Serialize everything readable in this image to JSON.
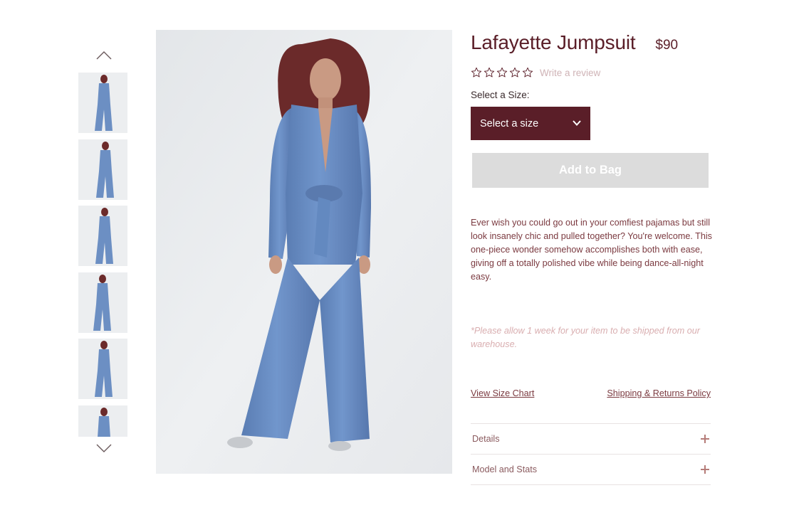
{
  "gallery": {
    "up_icon": "chevron-up-icon",
    "down_icon": "chevron-down-icon",
    "thumbnails": [
      {
        "active": true
      },
      {
        "active": false
      },
      {
        "active": false
      },
      {
        "active": false
      },
      {
        "active": false
      },
      {
        "active": false
      }
    ]
  },
  "product": {
    "title": "Lafayette Jumpsuit",
    "price": "$90",
    "rating": {
      "stars": 0,
      "max": 5,
      "review_link": "Write a review"
    },
    "size_label": "Select a Size:",
    "size_select_value": "Select a size",
    "add_to_bag": "Add to Bag",
    "description": "Ever wish you could go out in your comfiest pajamas but still look insanely chic and pulled together? You're welcome. This one-piece wonder somehow accomplishes both with ease, giving off a totally polished vibe while being dance-all-night easy.",
    "shipping_note": "*Please allow 1 week for your item to be shipped from our warehouse.",
    "links": {
      "size_chart": "View Size Chart",
      "shipping_returns": "Shipping & Returns Policy"
    },
    "accordion": [
      {
        "label": "Details"
      },
      {
        "label": "Model and Stats"
      }
    ]
  },
  "colors": {
    "brand": "#5a1e28",
    "button_disabled": "#dcdcdc",
    "jumpsuit": "#6c8fc3",
    "photo_background": "#e9ebed"
  }
}
